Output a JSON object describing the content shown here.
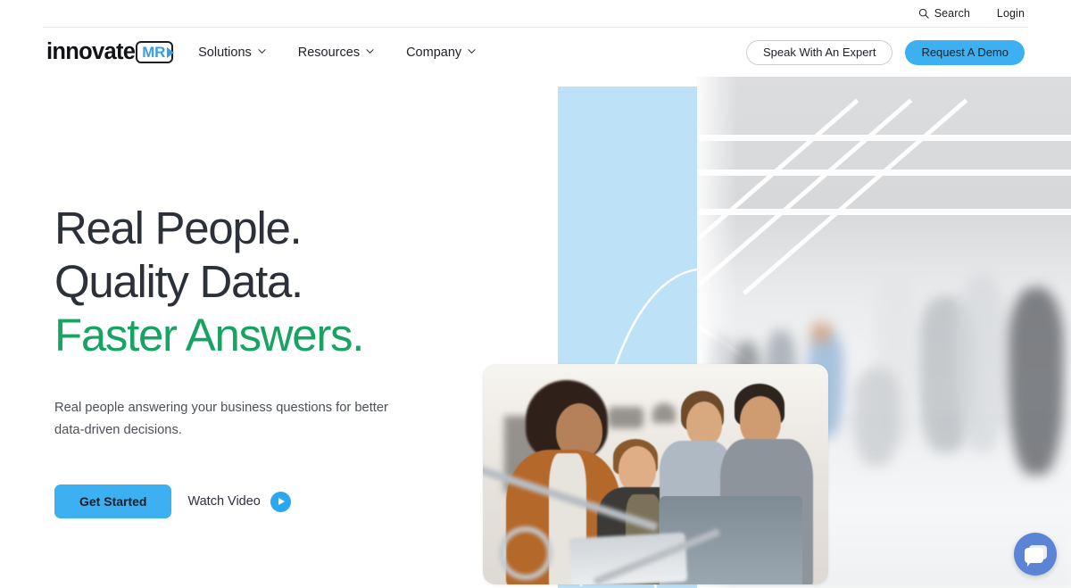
{
  "utility_bar": {
    "search": {
      "label": "Search",
      "icon": "search-icon"
    },
    "login": {
      "label": "Login"
    }
  },
  "brand": {
    "word": "innovate",
    "badge": "MR",
    "badge_arrow_icon": "play-arrow-icon",
    "badge_color": "#3a9fdb"
  },
  "nav": {
    "items": [
      {
        "label": "Solutions",
        "has_dropdown": true,
        "icon": "chevron-down-icon"
      },
      {
        "label": "Resources",
        "has_dropdown": true,
        "icon": "chevron-down-icon"
      },
      {
        "label": "Company",
        "has_dropdown": true,
        "icon": "chevron-down-icon"
      }
    ],
    "actions": {
      "secondary": {
        "label": "Speak With An Expert",
        "style": "outline"
      },
      "primary": {
        "label": "Request A Demo",
        "style": "filled",
        "color": "#3cb0f0"
      }
    }
  },
  "hero": {
    "headline_line1": "Real People.",
    "headline_line2": "Quality Data.",
    "headline_line3": "Faster Answers.",
    "headline_accent_color": "#17a463",
    "headline_color": "#2b3039",
    "subhead_line1": "Real people answering your business questions for better",
    "subhead_line2": "data-driven decisions.",
    "cta": {
      "label": "Get Started",
      "color": "#3cb0f0"
    },
    "video": {
      "label": "Watch Video",
      "icon": "play-icon",
      "icon_color": "#2aa8ef"
    },
    "art": {
      "panel_color": "#bde2f8",
      "photo_card_alt": "four colleagues in an office looking at a computer monitor",
      "background_alt": "blurred modern office lobby with people walking"
    }
  },
  "chat_widget": {
    "icon": "chat-bubbles-icon",
    "color": "#5b83d6",
    "label": "Open chat"
  }
}
